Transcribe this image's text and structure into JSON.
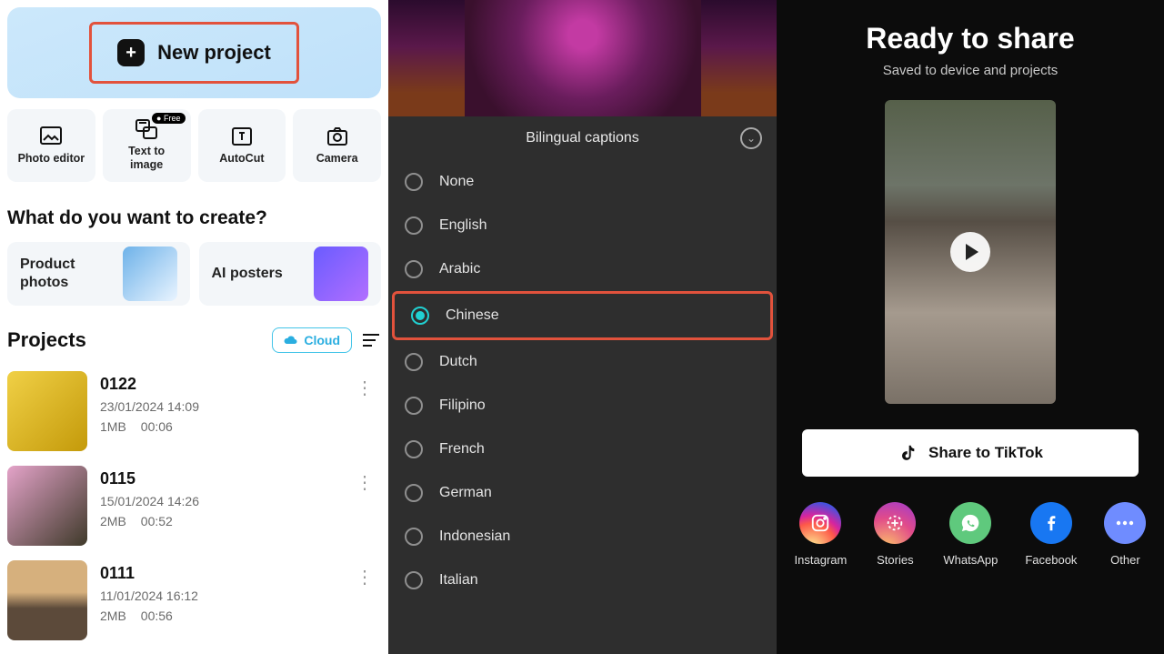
{
  "left": {
    "newProject": "New project",
    "tools": [
      {
        "label": "Photo editor"
      },
      {
        "label": "Text to\nimage",
        "badge": "Free"
      },
      {
        "label": "AutoCut"
      },
      {
        "label": "Camera"
      }
    ],
    "createHeading": "What do you want to create?",
    "createCards": [
      {
        "label": "Product\nphotos"
      },
      {
        "label": "AI posters"
      }
    ],
    "projectsTitle": "Projects",
    "cloudLabel": "Cloud",
    "projects": [
      {
        "name": "0122",
        "date": "23/01/2024 14:09",
        "size": "1MB",
        "duration": "00:06"
      },
      {
        "name": "0115",
        "date": "15/01/2024 14:26",
        "size": "2MB",
        "duration": "00:52"
      },
      {
        "name": "0111",
        "date": "11/01/2024 16:12",
        "size": "2MB",
        "duration": "00:56"
      }
    ]
  },
  "mid": {
    "panelTitle": "Bilingual captions",
    "options": [
      {
        "label": "None",
        "selected": false,
        "highlighted": false
      },
      {
        "label": "English",
        "selected": false,
        "highlighted": false
      },
      {
        "label": "Arabic",
        "selected": false,
        "highlighted": false
      },
      {
        "label": "Chinese",
        "selected": true,
        "highlighted": true
      },
      {
        "label": "Dutch",
        "selected": false,
        "highlighted": false
      },
      {
        "label": "Filipino",
        "selected": false,
        "highlighted": false
      },
      {
        "label": "French",
        "selected": false,
        "highlighted": false
      },
      {
        "label": "German",
        "selected": false,
        "highlighted": false
      },
      {
        "label": "Indonesian",
        "selected": false,
        "highlighted": false
      },
      {
        "label": "Italian",
        "selected": false,
        "highlighted": false
      }
    ]
  },
  "right": {
    "title": "Ready to share",
    "subtitle": "Saved to device and projects",
    "tiktokLabel": "Share to TikTok",
    "targets": [
      {
        "label": "Instagram"
      },
      {
        "label": "Stories"
      },
      {
        "label": "WhatsApp"
      },
      {
        "label": "Facebook"
      },
      {
        "label": "Other"
      }
    ]
  }
}
